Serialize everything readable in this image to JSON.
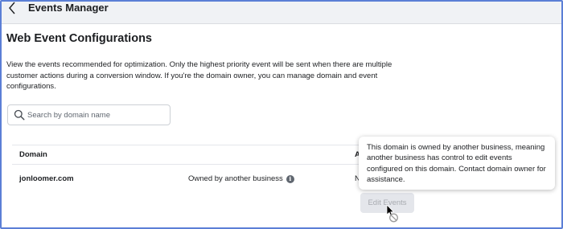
{
  "topbar": {
    "title": "Events Manager",
    "back_icon": "chevron-left-icon"
  },
  "page": {
    "title": "Web Event Configurations",
    "description": "View the events recommended for optimization. Only the highest priority event will be sent when there are multiple customer actions during a conversion window. If you're the domain owner, you can manage domain and event configurations."
  },
  "search": {
    "placeholder": "Search by domain name",
    "value": "",
    "icon": "search-icon"
  },
  "table": {
    "headers": [
      "Domain",
      "A"
    ],
    "rows": [
      {
        "domain": "jonloomer.com",
        "ownership": "Owned by another business",
        "ownership_icon": "info-icon",
        "action_partial": "N"
      }
    ]
  },
  "edit_button": {
    "label": "Edit Events",
    "disabled": true
  },
  "tooltip": {
    "text": "This domain is owned by another business, meaning another business has control to edit events configured on this domain. Contact domain owner for assistance."
  },
  "colors": {
    "frame_border": "#5b7fd6",
    "topbar_bg": "#f0f2f5",
    "disabled_button_bg": "#e4e6eb",
    "disabled_button_text": "#a8abb0",
    "text": "#1c1e21"
  }
}
